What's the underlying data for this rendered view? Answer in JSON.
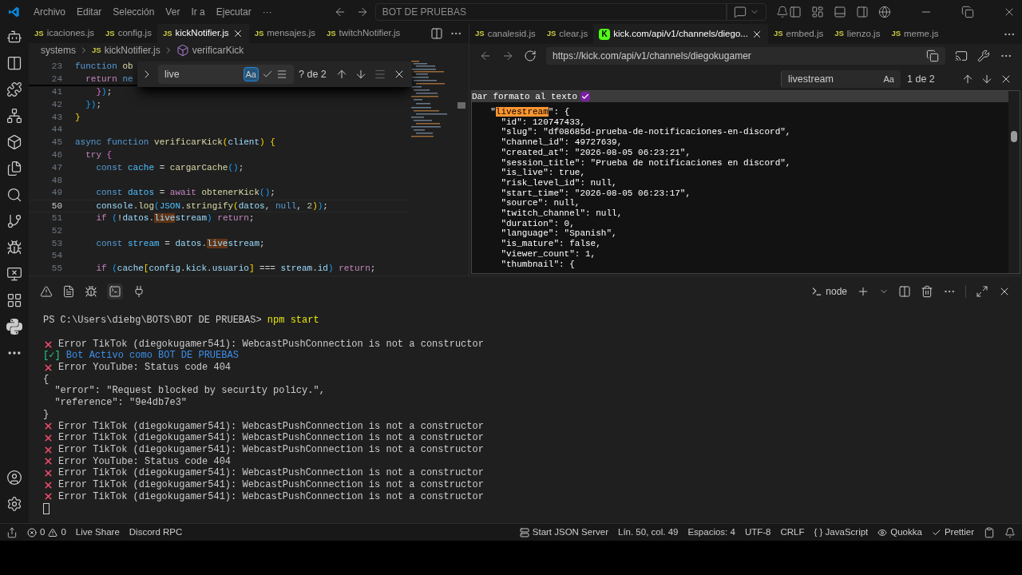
{
  "menu": [
    "Archivo",
    "Editar",
    "Selección",
    "Ver",
    "Ir a",
    "Ejecutar",
    "···"
  ],
  "command_center": "BOT DE PRUEBAS",
  "left_group": {
    "tabs": [
      {
        "label": "icaciones.js",
        "selected": false,
        "kind": "file",
        "icon_text": "JS"
      },
      {
        "label": "config.js",
        "selected": false,
        "kind": "file",
        "icon_text": "JS"
      },
      {
        "label": "kickNotifier.js",
        "selected": true,
        "kind": "file",
        "icon_text": "JS"
      },
      {
        "label": "mensajes.js",
        "selected": false,
        "kind": "file",
        "icon_text": "JS"
      },
      {
        "label": "twitchNotifier.js",
        "selected": false,
        "kind": "file",
        "icon_text": "JS"
      }
    ],
    "breadcrumbs": [
      {
        "text": "systems"
      },
      {
        "text": "kickNotifier.js",
        "icon_text": "JS"
      },
      {
        "text": "verificarKick"
      }
    ],
    "find": {
      "value": "live",
      "match_case_label": "Aa",
      "match_case": true,
      "whole_word": false,
      "regex": false,
      "result": "? de 2"
    },
    "lines": [
      {
        "num": "23",
        "current": false,
        "tokens": [
          {
            "text": "function ",
            "kind": "kw"
          },
          {
            "text": "ob",
            "kind": "fn"
          }
        ]
      },
      {
        "num": "24",
        "current": false,
        "tokens": [
          {
            "text": "  return ",
            "kind": "ctl"
          },
          {
            "text": "ne",
            "kind": "kw"
          }
        ]
      },
      {
        "num": "41",
        "current": false,
        "tokens": [
          {
            "text": "    }",
            "kind": "b2"
          },
          {
            "text": ")",
            "kind": "b3"
          },
          {
            "text": ";",
            "kind": "plain"
          }
        ]
      },
      {
        "num": "42",
        "current": false,
        "tokens": [
          {
            "text": "  })",
            "kind": "b3"
          },
          {
            "text": ";",
            "kind": "plain"
          }
        ]
      },
      {
        "num": "43",
        "current": false,
        "tokens": [
          {
            "text": "}",
            "kind": "b1"
          }
        ]
      },
      {
        "num": "44",
        "current": false
      },
      {
        "num": "45",
        "current": false,
        "tokens": [
          {
            "text": "async function ",
            "kind": "kw"
          },
          {
            "text": "verificarKick",
            "kind": "fn"
          },
          {
            "text": "(",
            "kind": "b1"
          },
          {
            "text": "client",
            "kind": "var"
          },
          {
            "text": ") {",
            "kind": "b1"
          }
        ]
      },
      {
        "num": "46",
        "current": false,
        "tokens": [
          {
            "text": "  try",
            "kind": "ctl"
          },
          {
            "text": " {",
            "kind": "b2"
          }
        ]
      },
      {
        "num": "47",
        "current": false,
        "tokens": [
          {
            "text": "    const ",
            "kind": "kw"
          },
          {
            "text": "cache",
            "kind": "const"
          },
          {
            "text": " = ",
            "kind": "plain"
          },
          {
            "text": "cargarCache",
            "kind": "fn"
          },
          {
            "text": "()",
            "kind": "b3"
          },
          {
            "text": ";",
            "kind": "plain"
          }
        ]
      },
      {
        "num": "48",
        "current": false
      },
      {
        "num": "49",
        "current": false,
        "tokens": [
          {
            "text": "    const ",
            "kind": "kw"
          },
          {
            "text": "datos",
            "kind": "const"
          },
          {
            "text": " = ",
            "kind": "plain"
          },
          {
            "text": "await ",
            "kind": "ctl"
          },
          {
            "text": "obtenerKick",
            "kind": "fn"
          },
          {
            "text": "()",
            "kind": "b3"
          },
          {
            "text": ";",
            "kind": "plain"
          }
        ]
      },
      {
        "num": "50",
        "current": true,
        "tokens": [
          {
            "text": "    console",
            "kind": "var"
          },
          {
            "text": ".",
            "kind": "plain"
          },
          {
            "text": "log",
            "kind": "fn"
          },
          {
            "text": "(",
            "kind": "b3"
          },
          {
            "text": "JSON",
            "kind": "const"
          },
          {
            "text": ".",
            "kind": "plain"
          },
          {
            "text": "stringify",
            "kind": "fn"
          },
          {
            "text": "(",
            "kind": "b1"
          },
          {
            "text": "datos",
            "kind": "var"
          },
          {
            "text": ", ",
            "kind": "plain"
          },
          {
            "text": "null",
            "kind": "kw"
          },
          {
            "text": ", ",
            "kind": "plain"
          },
          {
            "text": "2",
            "kind": "num"
          },
          {
            "text": ")",
            "kind": "b1"
          },
          {
            "text": ")",
            "kind": "b3"
          },
          {
            "text": ";",
            "kind": "plain"
          }
        ]
      },
      {
        "num": "51",
        "current": false,
        "tokens": [
          {
            "text": "    if ",
            "kind": "ctl"
          },
          {
            "text": "(",
            "kind": "b3"
          },
          {
            "text": "!",
            "kind": "plain"
          },
          {
            "text": "datos",
            "kind": "var"
          },
          {
            "text": ".",
            "kind": "plain"
          },
          {
            "text": "live",
            "kind": "match"
          },
          {
            "text": "stream",
            "kind": "var"
          },
          {
            "text": ")",
            "kind": "b3"
          },
          {
            "text": " return",
            "kind": "ctl"
          },
          {
            "text": ";",
            "kind": "plain"
          }
        ]
      },
      {
        "num": "52",
        "current": false
      },
      {
        "num": "53",
        "current": false,
        "tokens": [
          {
            "text": "    const ",
            "kind": "kw"
          },
          {
            "text": "stream",
            "kind": "const"
          },
          {
            "text": " = ",
            "kind": "plain"
          },
          {
            "text": "datos",
            "kind": "var"
          },
          {
            "text": ".",
            "kind": "plain"
          },
          {
            "text": "live",
            "kind": "match"
          },
          {
            "text": "stream",
            "kind": "var"
          },
          {
            "text": ";",
            "kind": "plain"
          }
        ]
      },
      {
        "num": "54",
        "current": false
      },
      {
        "num": "55",
        "current": false,
        "tokens": [
          {
            "text": "    if ",
            "kind": "ctl"
          },
          {
            "text": "(",
            "kind": "b3"
          },
          {
            "text": "cache",
            "kind": "var"
          },
          {
            "text": "[",
            "kind": "b1"
          },
          {
            "text": "config",
            "kind": "var"
          },
          {
            "text": ".",
            "kind": "plain"
          },
          {
            "text": "kick",
            "kind": "var"
          },
          {
            "text": ".",
            "kind": "plain"
          },
          {
            "text": "usuario",
            "kind": "var"
          },
          {
            "text": "]",
            "kind": "b1"
          },
          {
            "text": " === ",
            "kind": "plain"
          },
          {
            "text": "stream",
            "kind": "var"
          },
          {
            "text": ".",
            "kind": "plain"
          },
          {
            "text": "id",
            "kind": "var"
          },
          {
            "text": ")",
            "kind": "b3"
          },
          {
            "text": " return",
            "kind": "ctl"
          },
          {
            "text": ";",
            "kind": "plain"
          }
        ]
      }
    ]
  },
  "right_group": {
    "tabs": [
      {
        "label": "canalesid.js",
        "selected": false,
        "kind": "file",
        "icon_text": "JS"
      },
      {
        "label": "clear.js",
        "selected": false,
        "kind": "file",
        "icon_text": "JS"
      },
      {
        "label": "kick.com/api/v1/channels/diego...",
        "selected": true,
        "kind": "browser",
        "icon_text": "K"
      },
      {
        "label": "embed.js",
        "selected": false,
        "kind": "file",
        "icon_text": "JS"
      },
      {
        "label": "lienzo.js",
        "selected": false,
        "kind": "file",
        "icon_text": "JS"
      },
      {
        "label": "meme.js",
        "selected": false,
        "kind": "file",
        "icon_text": "JS"
      }
    ],
    "url": "https://kick.com/api/v1/channels/diegokugamer",
    "find": {
      "value": "livestream",
      "match_case_label": "Aa",
      "result": "1 de 2"
    },
    "pretty_print": {
      "label": "Dar formato al texto",
      "checked": true
    },
    "json_lines": [
      {
        "segments": [
          {
            "t": "  \""
          },
          {
            "t": "livestream",
            "match": true
          },
          {
            "t": "\": {"
          }
        ]
      },
      {
        "segments": [
          {
            "t": "    \"id\": 120747433,"
          }
        ]
      },
      {
        "segments": [
          {
            "t": "    \"slug\": \"df08685d-prueba-de-notificaciones-en-discord\","
          }
        ]
      },
      {
        "segments": [
          {
            "t": "    \"channel_id\": 49727639,"
          }
        ]
      },
      {
        "segments": [
          {
            "t": "    \"created_at\": \"2026-08-05 06:23:21\","
          }
        ]
      },
      {
        "segments": [
          {
            "t": "    \"session_title\": \"Prueba de notificaciones en discord\","
          }
        ]
      },
      {
        "segments": [
          {
            "t": "    \"is_live\": true,"
          }
        ]
      },
      {
        "segments": [
          {
            "t": "    \"risk_level_id\": null,"
          }
        ]
      },
      {
        "segments": [
          {
            "t": "    \"start_time\": \"2026-08-05 06:23:17\","
          }
        ]
      },
      {
        "segments": [
          {
            "t": "    \"source\": null,"
          }
        ]
      },
      {
        "segments": [
          {
            "t": "    \"twitch_channel\": null,"
          }
        ]
      },
      {
        "segments": [
          {
            "t": "    \"duration\": 0,"
          }
        ]
      },
      {
        "segments": [
          {
            "t": "    \"language\": \"Spanish\","
          }
        ]
      },
      {
        "segments": [
          {
            "t": "    \"is_mature\": false,"
          }
        ]
      },
      {
        "segments": [
          {
            "t": "    \"viewer_count\": 1,"
          }
        ]
      },
      {
        "segments": [
          {
            "t": "    \"thumbnail\": {"
          }
        ]
      }
    ]
  },
  "panel": {
    "terminal_name": "node",
    "lines": [
      {
        "kind": "prompt",
        "text": "PS C:\\Users\\diebg\\BOTS\\BOT DE PRUEBAS>",
        "command": "npm start"
      },
      {
        "kind": "blank"
      },
      {
        "kind": "error",
        "text": "Error TikTok (diegokugamer541): WebcastPushConnection is not a constructor"
      },
      {
        "kind": "success",
        "prefix": "[✓]",
        "text": "Bot Activo como BOT DE PRUEBAS"
      },
      {
        "kind": "error",
        "text": "Error YouTube: Status code 404"
      },
      {
        "kind": "plain",
        "text": "{"
      },
      {
        "kind": "plain",
        "text": "  \"error\": \"Request blocked by security policy.\","
      },
      {
        "kind": "plain",
        "text": "  \"reference\": \"9e4db7e3\""
      },
      {
        "kind": "plain",
        "text": "}"
      },
      {
        "kind": "error",
        "text": "Error TikTok (diegokugamer541): WebcastPushConnection is not a constructor"
      },
      {
        "kind": "error",
        "text": "Error TikTok (diegokugamer541): WebcastPushConnection is not a constructor"
      },
      {
        "kind": "error",
        "text": "Error TikTok (diegokugamer541): WebcastPushConnection is not a constructor"
      },
      {
        "kind": "error",
        "text": "Error YouTube: Status code 404"
      },
      {
        "kind": "error",
        "text": "Error TikTok (diegokugamer541): WebcastPushConnection is not a constructor"
      },
      {
        "kind": "error",
        "text": "Error TikTok (diegokugamer541): WebcastPushConnection is not a constructor"
      },
      {
        "kind": "error",
        "text": "Error TikTok (diegokugamer541): WebcastPushConnection is not a constructor"
      },
      {
        "kind": "cursor"
      }
    ]
  },
  "status_bar": {
    "errors": "0",
    "warnings": "0",
    "left": [
      "Live Share",
      "Discord RPC"
    ],
    "right": [
      {
        "kind": "server",
        "text": "Start JSON Server"
      },
      {
        "kind": "text",
        "text": "Lín. 50, col. 49"
      },
      {
        "kind": "text",
        "text": "Espacios: 4"
      },
      {
        "kind": "text",
        "text": "UTF-8"
      },
      {
        "kind": "text",
        "text": "CRLF"
      },
      {
        "kind": "language",
        "text": "{ } JavaScript"
      },
      {
        "kind": "quokka",
        "text": "Quokka"
      },
      {
        "kind": "prettier",
        "text": "Prettier"
      }
    ]
  }
}
